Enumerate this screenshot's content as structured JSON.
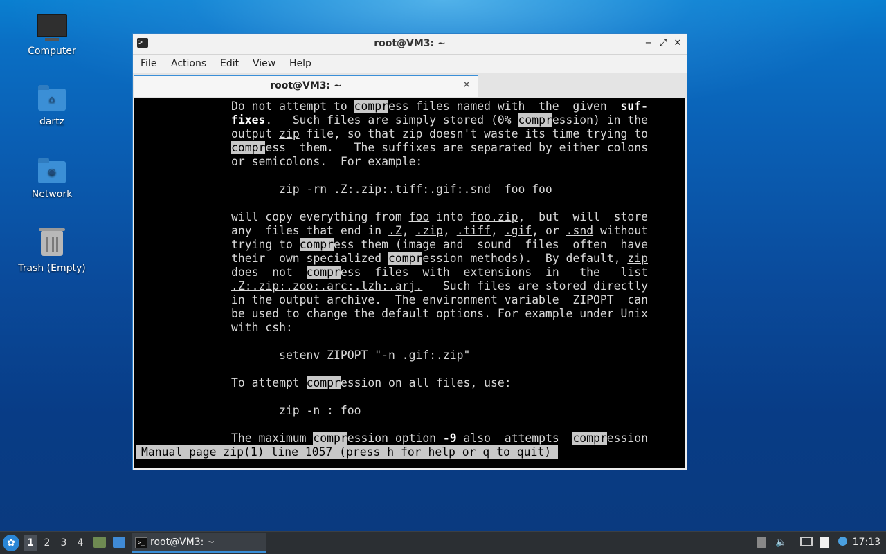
{
  "desktop": {
    "icons": [
      {
        "label": "Computer",
        "icon": "computer-icon"
      },
      {
        "label": "dartz",
        "icon": "home-folder-icon"
      },
      {
        "label": "Network",
        "icon": "network-folder-icon"
      },
      {
        "label": "Trash (Empty)",
        "icon": "trash-icon"
      }
    ]
  },
  "window": {
    "title": "root@VM3: ~",
    "controls": {
      "minimize": "−",
      "maximize": "⤢",
      "close": "✕"
    },
    "menu": [
      "File",
      "Actions",
      "Edit",
      "View",
      "Help"
    ],
    "tab": {
      "label": "root@VM3: ~",
      "close": "✕"
    }
  },
  "terminal": {
    "lines": [
      "Do not attempt to compress files named with  the  given  suf-",
      "fixes.   Such files are simply stored (0% compression) in the",
      "output zip file, so that zip doesn't waste its time trying to",
      "compress  them.   The suffixes are separated by either colons",
      "or semicolons.  For example:",
      "",
      "       zip -rn .Z:.zip:.tiff:.gif:.snd  foo foo",
      "",
      "will copy everything from foo into foo.zip,  but  will  store",
      "any  files that end in .Z, .zip, .tiff, .gif, or .snd without",
      "trying to compress them (image and  sound  files  often  have",
      "their  own specialized compression methods).  By default, zip",
      "does  not  compress  files  with  extensions  in   the   list",
      ".Z:.zip:.zoo:.arc:.lzh:.arj.   Such files are stored directly",
      "in the output archive.  The environment variable  ZIPOPT  can",
      "be used to change the default options. For example under Unix",
      "with csh:",
      "",
      "       setenv ZIPOPT \"-n .gif:.zip\"",
      "",
      "To attempt compression on all files, use:",
      "",
      "       zip -n : foo",
      "",
      "The maximum compression option -9 also  attempts  compression"
    ],
    "search_highlight": "compr",
    "status_line": "Manual page zip(1) line 1057 (press h for help or q to quit)"
  },
  "taskbar": {
    "workspaces": [
      "1",
      "2",
      "3",
      "4"
    ],
    "active_workspace": "1",
    "task_label": "root@VM3: ~",
    "clock": "17:13"
  }
}
